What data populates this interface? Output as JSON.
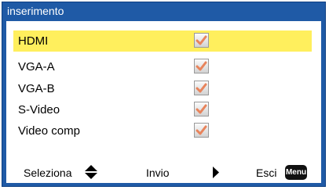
{
  "window": {
    "title": "inserimento"
  },
  "sources": [
    {
      "label": "HDMI",
      "checked": true,
      "selected": true
    },
    {
      "label": "VGA-A",
      "checked": true,
      "selected": false
    },
    {
      "label": "VGA-B",
      "checked": true,
      "selected": false
    },
    {
      "label": "S-Video",
      "checked": true,
      "selected": false
    },
    {
      "label": "Video comp",
      "checked": true,
      "selected": false
    }
  ],
  "footer": {
    "select_label": "Seleziona",
    "enter_label": "Invio",
    "exit_label": "Esci",
    "menu_key_label": "Menu"
  },
  "icons": {
    "select": "up-down-arrows-icon",
    "enter": "right-triangle-icon",
    "exit": "menu-key-icon",
    "check": "checkmark-icon"
  },
  "colors": {
    "frame": "#1f5aa6",
    "selected_row": "#ffef5d",
    "check_mark": "#e8845c"
  }
}
